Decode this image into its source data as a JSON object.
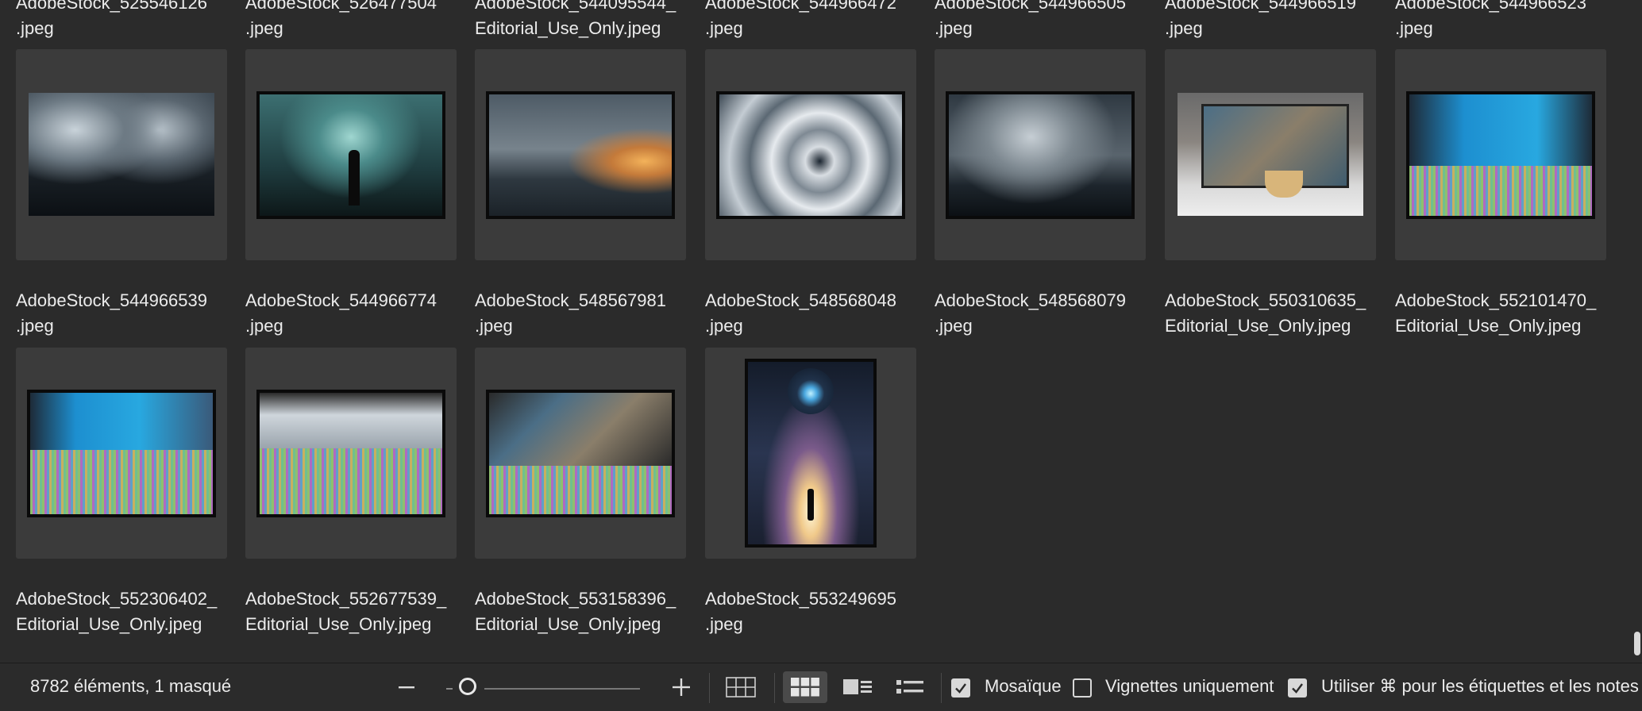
{
  "rows": [
    {
      "items": [
        {
          "caption_top": "AdobeStock_525546126\n.jpeg",
          "thumb": "cave-image"
        },
        {
          "caption_top": "AdobeStock_526477504\n.jpeg",
          "thumb": "figure-creature-image"
        },
        {
          "caption_top": "AdobeStock_544095544_\nEditorial_Use_Only.jpeg",
          "thumb": "storm-sunset-image"
        },
        {
          "caption_top": "AdobeStock_544966472\n.jpeg",
          "thumb": "cloud-swirl-image"
        },
        {
          "caption_top": "AdobeStock_544966505\n.jpeg",
          "thumb": "dark-storm-image"
        },
        {
          "caption_top": "AdobeStock_544966519\n.jpeg",
          "thumb": "tv-popcorn-image"
        },
        {
          "caption_top": "AdobeStock_544966523\n.jpeg",
          "thumb": "avatar-corrupted-image"
        }
      ]
    },
    {
      "items": [
        {
          "caption_top": "AdobeStock_544966539\n.jpeg",
          "thumb": "corrupted-1"
        },
        {
          "caption_top": "AdobeStock_544966774\n.jpeg",
          "thumb": "corrupted-2"
        },
        {
          "caption_top": "AdobeStock_548567981\n.jpeg",
          "thumb": "corrupted-3"
        },
        {
          "caption_top": "AdobeStock_548568048\n.jpeg",
          "thumb": "astronaut-image"
        },
        {
          "caption_top": "AdobeStock_548568079\n.jpeg",
          "thumb": ""
        },
        {
          "caption_top": "AdobeStock_550310635_\nEditorial_Use_Only.jpeg",
          "thumb": ""
        },
        {
          "caption_top": "AdobeStock_552101470_\nEditorial_Use_Only.jpeg",
          "thumb": ""
        }
      ]
    }
  ],
  "bottom_captions": [
    "AdobeStock_552306402_\nEditorial_Use_Only.jpeg",
    "AdobeStock_552677539_\nEditorial_Use_Only.jpeg",
    "AdobeStock_553158396_\nEditorial_Use_Only.jpeg",
    "AdobeStock_553249695\n.jpeg"
  ],
  "status": {
    "count": "8782 éléments, 1 masqué",
    "zoom_out_icon": "minus-icon",
    "zoom_in_icon": "plus-icon",
    "zoom_level": 0.1,
    "views": [
      "grid-outline-icon",
      "grid-filled-icon",
      "detail-view-icon",
      "list-view-icon"
    ],
    "active_view": 1,
    "mosaic_label": "Mosaïque",
    "mosaic_checked": true,
    "thumbs_only_label": "Vignettes uniquement",
    "thumbs_only_checked": false,
    "labels_notes_label": "Utiliser ⌘ pour les étiquettes et les notes",
    "labels_notes_checked": true
  }
}
